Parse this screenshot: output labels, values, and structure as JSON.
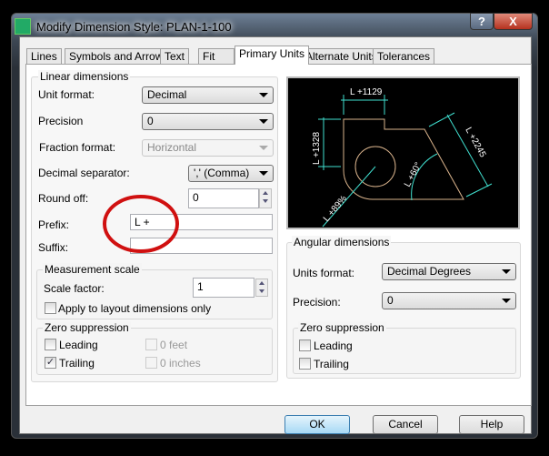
{
  "window": {
    "title": "Modify Dimension Style: PLAN-1-100",
    "help_label": "?",
    "close_label": "X"
  },
  "tabs": [
    {
      "label": "Lines"
    },
    {
      "label": "Symbols and Arrows"
    },
    {
      "label": "Text"
    },
    {
      "label": "Fit"
    },
    {
      "label": "Primary Units",
      "active": true
    },
    {
      "label": "Alternate Units"
    },
    {
      "label": "Tolerances"
    }
  ],
  "linear": {
    "title": "Linear dimensions",
    "unit_format": {
      "label": "Unit format:",
      "value": "Decimal"
    },
    "precision": {
      "label": "Precision",
      "value": "0"
    },
    "fraction_format": {
      "label": "Fraction format:",
      "value": "Horizontal",
      "disabled": true
    },
    "decimal_separator": {
      "label": "Decimal separator:",
      "value": "',' (Comma)"
    },
    "round_off": {
      "label": "Round off:",
      "value": "0"
    },
    "prefix": {
      "label": "Prefix:",
      "value": "L +"
    },
    "suffix": {
      "label": "Suffix:",
      "value": ""
    },
    "measurement_scale": {
      "title": "Measurement scale",
      "scale_factor_label": "Scale factor:",
      "scale_factor": "1",
      "apply_layout_label": "Apply to layout dimensions only",
      "apply_layout_checked": false
    },
    "zero_suppression": {
      "title": "Zero suppression",
      "leading": "Leading",
      "leading_checked": false,
      "trailing": "Trailing",
      "trailing_checked": true,
      "feet": "0 feet",
      "inches": "0 inches"
    }
  },
  "preview": {
    "labels": {
      "top": "L +1129",
      "left": "L +1328",
      "right": "L +2245",
      "angle": "L +60°",
      "radius": "L +89%"
    },
    "colors": {
      "dim": "#40e0d0",
      "shape": "#d9b38c"
    }
  },
  "angular": {
    "title": "Angular dimensions",
    "units_format": {
      "label": "Units format:",
      "value": "Decimal Degrees"
    },
    "precision": {
      "label": "Precision:",
      "value": "0"
    },
    "zero_suppression": {
      "title": "Zero suppression",
      "leading": "Leading",
      "trailing": "Trailing"
    }
  },
  "annotation": {
    "color": "#d01010"
  },
  "buttons": {
    "ok": "OK",
    "cancel": "Cancel",
    "help": "Help"
  }
}
